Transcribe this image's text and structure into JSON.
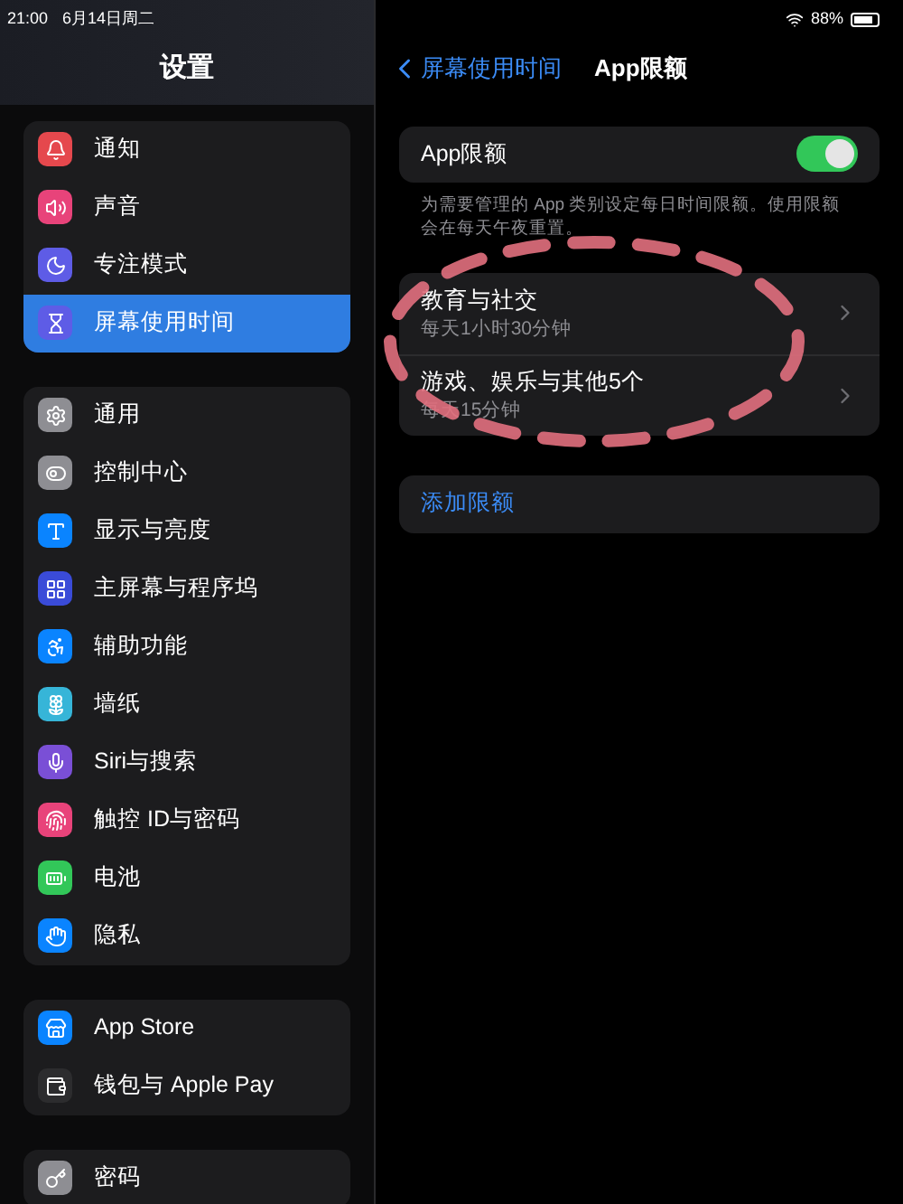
{
  "status_bar": {
    "time": "21:00",
    "date": "6月14日周二",
    "battery": "88%"
  },
  "sidebar": {
    "title": "设置",
    "groups": [
      {
        "items": [
          {
            "label": "通知",
            "selected": false
          },
          {
            "label": "声音",
            "selected": false
          },
          {
            "label": "专注模式",
            "selected": false
          },
          {
            "label": "屏幕使用时间",
            "selected": true
          }
        ]
      },
      {
        "items": [
          {
            "label": "通用",
            "selected": false
          },
          {
            "label": "控制中心",
            "selected": false
          },
          {
            "label": "显示与亮度",
            "selected": false
          },
          {
            "label": "主屏幕与程序坞",
            "selected": false
          },
          {
            "label": "辅助功能",
            "selected": false
          },
          {
            "label": "墙纸",
            "selected": false
          },
          {
            "label": "Siri与搜索",
            "selected": false
          },
          {
            "label": "触控 ID与密码",
            "selected": false
          },
          {
            "label": "电池",
            "selected": false
          },
          {
            "label": "隐私",
            "selected": false
          }
        ]
      },
      {
        "items": [
          {
            "label": "App Store",
            "selected": false
          },
          {
            "label": "钱包与 Apple Pay",
            "selected": false
          }
        ]
      },
      {
        "items": [
          {
            "label": "密码",
            "selected": false
          }
        ]
      }
    ]
  },
  "detail": {
    "back": "屏幕使用时间",
    "title": "App限额",
    "toggle": {
      "label": "App限额",
      "on": true
    },
    "description": "为需要管理的 App 类别设定每日时间限额。使用限额会在每天午夜重置。",
    "limits": [
      {
        "title": "教育与社交",
        "subtitle": "每天1小时30分钟"
      },
      {
        "title": "游戏、娱乐与其他5个",
        "subtitle": "每天15分钟"
      }
    ],
    "add": "添加限额"
  }
}
